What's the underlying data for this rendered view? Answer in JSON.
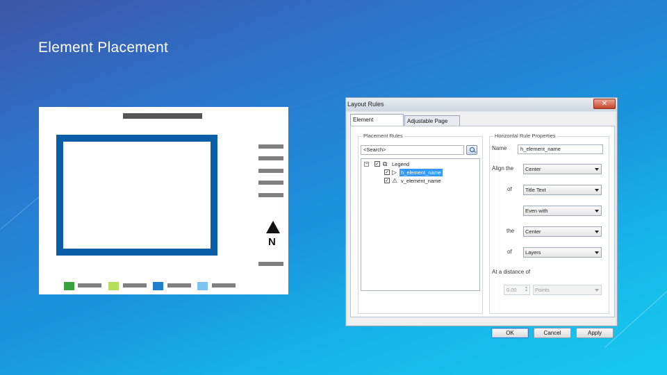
{
  "slide": {
    "title": "Element Placement"
  },
  "diagram": {
    "north_label": "N",
    "legend_swatches": [
      {
        "color": "#3aa23f",
        "icon": "legend-swatch-green"
      },
      {
        "color": "#b6e05a",
        "icon": "legend-swatch-lime"
      },
      {
        "color": "#1f7fcc",
        "icon": "legend-swatch-blue"
      },
      {
        "color": "#7cc4f0",
        "icon": "legend-swatch-light-blue"
      }
    ]
  },
  "dialog": {
    "title": "Layout Rules",
    "close_glyph": "✕",
    "tabs": [
      {
        "label": "Element Placement",
        "active": true
      },
      {
        "label": "Adjustable Page Size",
        "active": false
      }
    ],
    "placement_rules": {
      "group_label": "Placement Rules",
      "search_value": "<Search>",
      "tree": [
        {
          "label": "Legend",
          "checked": true,
          "expander": "⊟",
          "icon": "legend-copy-icon"
        },
        {
          "label": "h_element_name",
          "checked": true,
          "selected": true,
          "icon": "play-arrow-icon"
        },
        {
          "label": "v_element_name",
          "checked": true,
          "selected": false,
          "icon": "warning-icon"
        }
      ]
    },
    "horizontal_rule": {
      "group_label": "Horizontal Rule Properties",
      "name_label": "Name",
      "name_value": "h_element_name",
      "align_label": "Align the",
      "align_value": "Center",
      "of_label_1": "of",
      "of_value_1": "Title Text",
      "even_with_value": "Even with",
      "the_label": "the",
      "the_value": "Center",
      "of_label_2": "of",
      "of_value_2": "Layers",
      "distance_label": "At a distance of",
      "distance_value": "0.00",
      "distance_unit": "Points"
    },
    "buttons": {
      "ok": "OK",
      "cancel": "Cancel",
      "apply": "Apply"
    }
  }
}
